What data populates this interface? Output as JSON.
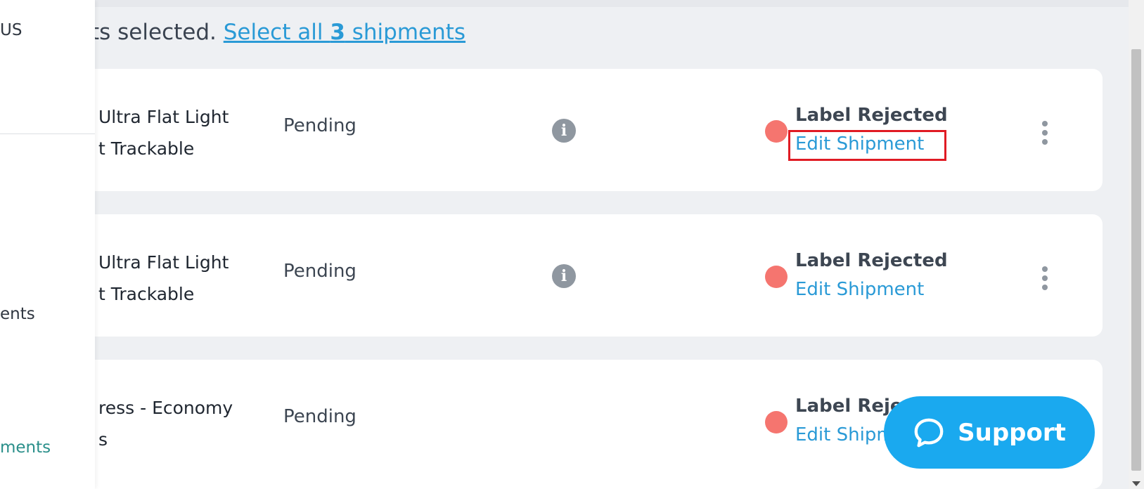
{
  "sidebar": {
    "item_top": "US",
    "item_mid": "ents",
    "item_bottom": "ments"
  },
  "selection": {
    "prefix": "ts selected.",
    "link_before": "Select all ",
    "link_count": "3",
    "link_after": " shipments"
  },
  "rows": [
    {
      "service_line1": "Ultra Flat Light",
      "service_line2": "t Trackable",
      "status": "Pending",
      "info_icon": "info-icon",
      "label_status": "Label Rejected",
      "action": "Edit Shipment"
    },
    {
      "service_line1": "Ultra Flat Light",
      "service_line2": "t Trackable",
      "status": "Pending",
      "info_icon": "info-icon",
      "label_status": "Label Rejected",
      "action": "Edit Shipment"
    },
    {
      "service_line1": "ress - Economy",
      "service_line2": "s",
      "status": "Pending",
      "label_status": "Label Rejected",
      "action": "Edit Shipment"
    }
  ],
  "support": {
    "label": "Support",
    "icon": "chat-bubble-icon"
  },
  "colors": {
    "accent_link": "#2a9ad6",
    "status_dot": "#f5756f",
    "support_bg": "#1aa9ef",
    "highlight": "#e01b24"
  }
}
